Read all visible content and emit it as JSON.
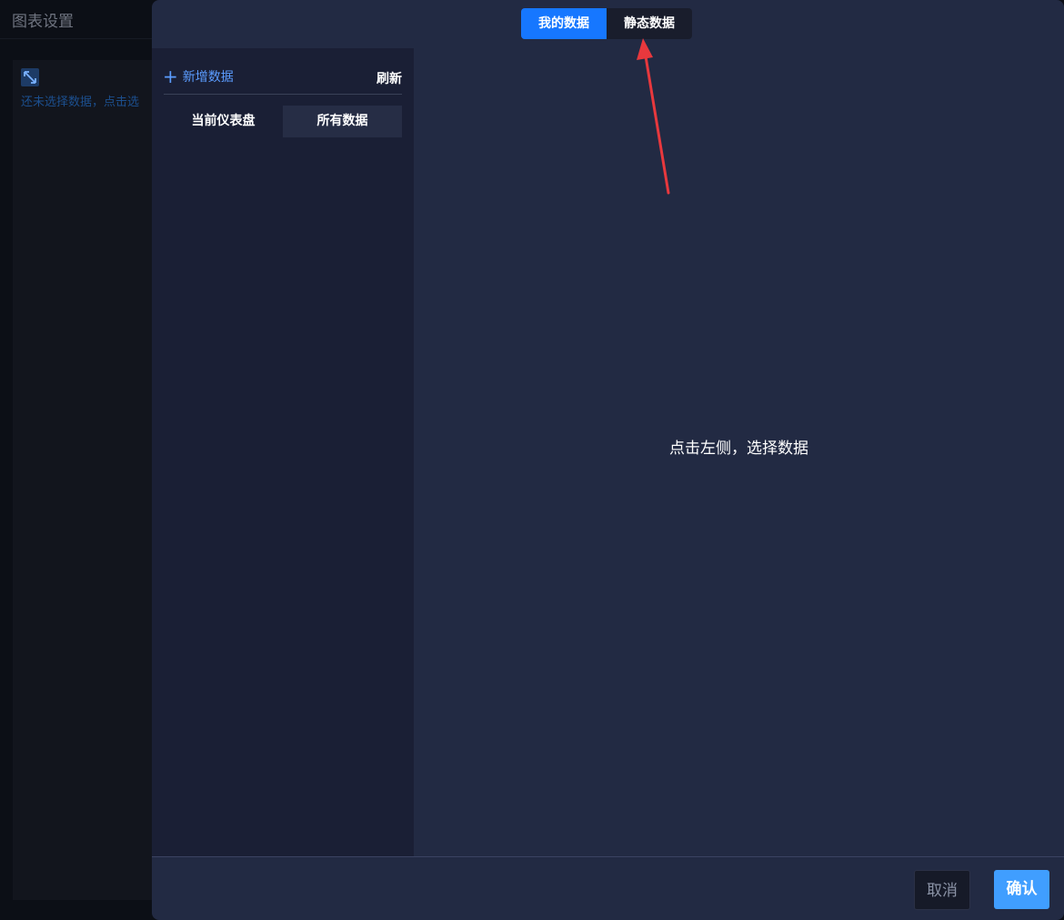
{
  "background": {
    "title": "图表设置",
    "hint": "还未选择数据，点击选"
  },
  "tabs": [
    {
      "label": "我的数据",
      "active": true
    },
    {
      "label": "静态数据",
      "active": false
    }
  ],
  "sidebar": {
    "add_label": "新增数据",
    "refresh_label": "刷新",
    "subtabs": [
      {
        "label": "当前仪表盘",
        "selected": false
      },
      {
        "label": "所有数据",
        "selected": true
      }
    ]
  },
  "main": {
    "hint": "点击左侧，选择数据"
  },
  "footer": {
    "cancel_label": "取消",
    "confirm_label": "确认"
  },
  "colors": {
    "accent": "#1677ff",
    "confirm": "#409eff",
    "link": "#5b9cff",
    "annotation_arrow": "#e8383d"
  },
  "icons": {
    "expand": "expand-arrows-icon",
    "add": "plus-icon"
  }
}
